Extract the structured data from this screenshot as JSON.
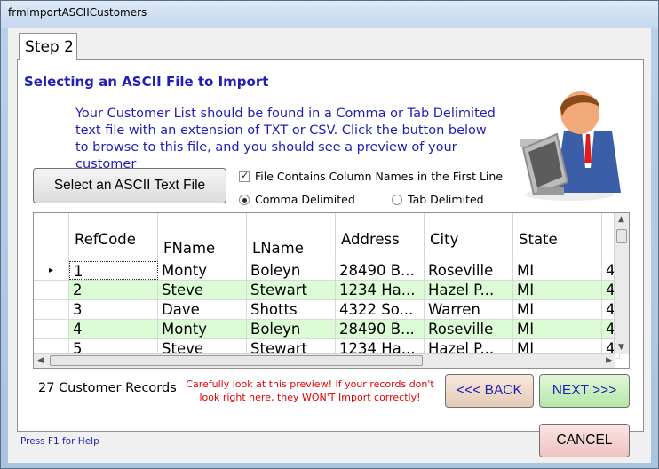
{
  "window": {
    "title": "frmImportASCIICustomers"
  },
  "tab": {
    "label": "Step 2"
  },
  "heading": "Selecting an ASCII File to Import",
  "description": "Your Customer List should be found in a Comma or Tab Delimited text file with an extension of TXT or CSV.  Click the button below to browse to this file, and you should see a preview of your customer",
  "select_button": "Select an ASCII Text File",
  "options": {
    "column_names_label": "File Contains Column Names in the First Line",
    "column_names_checked": true,
    "comma_label": "Comma Delimited",
    "tab_label": "Tab Delimited",
    "selected_delimiter": "comma"
  },
  "grid": {
    "columns": [
      "RefCode",
      "FName",
      "LName",
      "Address",
      "City",
      "State"
    ],
    "rows": [
      [
        "1",
        "Monty",
        "Boleyn",
        "28490 B...",
        "Roseville",
        "MI",
        "4"
      ],
      [
        "2",
        "Steve",
        "Stewart",
        "1234 Ha...",
        "Hazel P...",
        "MI",
        "4"
      ],
      [
        "3",
        "Dave",
        "Shotts",
        "4322 So...",
        "Warren",
        "MI",
        "4"
      ],
      [
        "4",
        "Monty",
        "Boleyn",
        "28490 B...",
        "Roseville",
        "MI",
        "4"
      ],
      [
        "5",
        "Steve",
        "Stewart",
        "1234 Ha...",
        "Hazel P...",
        "MI",
        "4"
      ]
    ],
    "current_row_marker": "▸"
  },
  "record_count": "27 Customer Records",
  "warning": "Carefully look at this preview!  If your records don't look right here, they WON'T Import correctly!",
  "buttons": {
    "back": "<<< BACK",
    "next": "NEXT >>>",
    "cancel": "CANCEL"
  },
  "help": "Press F1 for Help"
}
